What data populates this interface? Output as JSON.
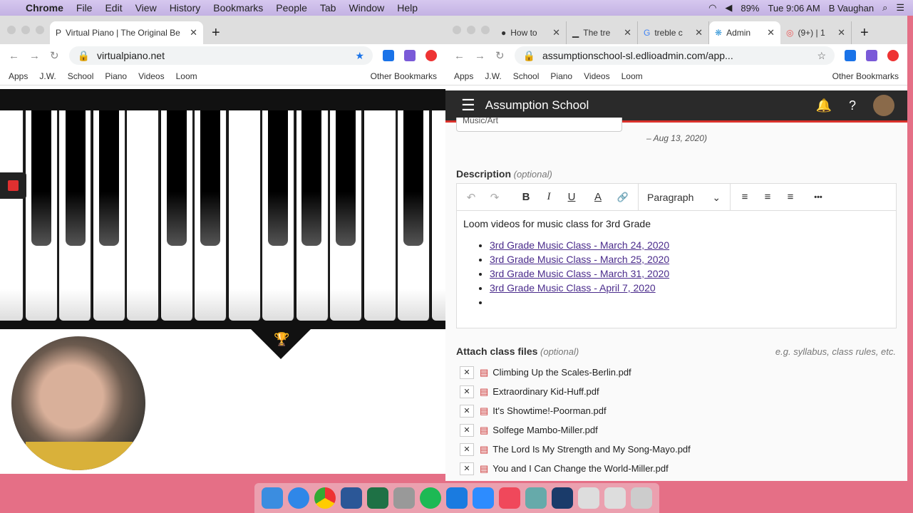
{
  "menubar": {
    "apple": "",
    "app": "Chrome",
    "items": [
      "File",
      "Edit",
      "View",
      "History",
      "Bookmarks",
      "People",
      "Tab",
      "Window",
      "Help"
    ],
    "battery": "89%",
    "clock": "Tue 9:06 AM",
    "user": "B Vaughan"
  },
  "left": {
    "tab": "Virtual Piano | The Original Be",
    "url": "virtualpiano.net",
    "bookmarks": [
      "Apps",
      "J.W.",
      "School",
      "Piano",
      "Videos",
      "Loom"
    ],
    "other": "Other Bookmarks"
  },
  "right": {
    "tabs": [
      "How to",
      "The tre",
      "treble c",
      "Admin",
      "(9+) | 1"
    ],
    "url": "assumptionschool-sl.edlioadmin.com/app...",
    "bookmarks": [
      "Apps",
      "J.W.",
      "School",
      "Piano",
      "Videos",
      "Loom"
    ],
    "other": "Other Bookmarks",
    "app_title": "Assumption School",
    "field_value": "Music/Art",
    "date_note": "– Aug 13, 2020)",
    "description_label": "Description",
    "optional": "(optional)",
    "toolbar": {
      "undo": "↶",
      "redo": "↷",
      "bold": "B",
      "italic": "I",
      "underline": "U",
      "color": "A",
      "link": "🔗",
      "format": "Paragraph",
      "more": "•••"
    },
    "editor_text": "Loom videos for music class for 3rd Grade",
    "links": [
      "3rd Grade Music Class - March 24, 2020",
      "3rd Grade Music Class - March 25, 2020",
      "3rd Grade Music Class - March 31, 2020",
      "3rd Grade Music Class - April 7, 2020"
    ],
    "attach_label": "Attach class files",
    "attach_hint": "e.g. syllabus, class rules, etc.",
    "files": [
      "Climbing Up the Scales-Berlin.pdf",
      "Extraordinary Kid-Huff.pdf",
      "It's Showtime!-Poorman.pdf",
      "Solfege Mambo-Miller.pdf",
      "The Lord Is My Strength and My Song-Mayo.pdf",
      "You and I Can Change the World-Miller.pdf"
    ]
  }
}
